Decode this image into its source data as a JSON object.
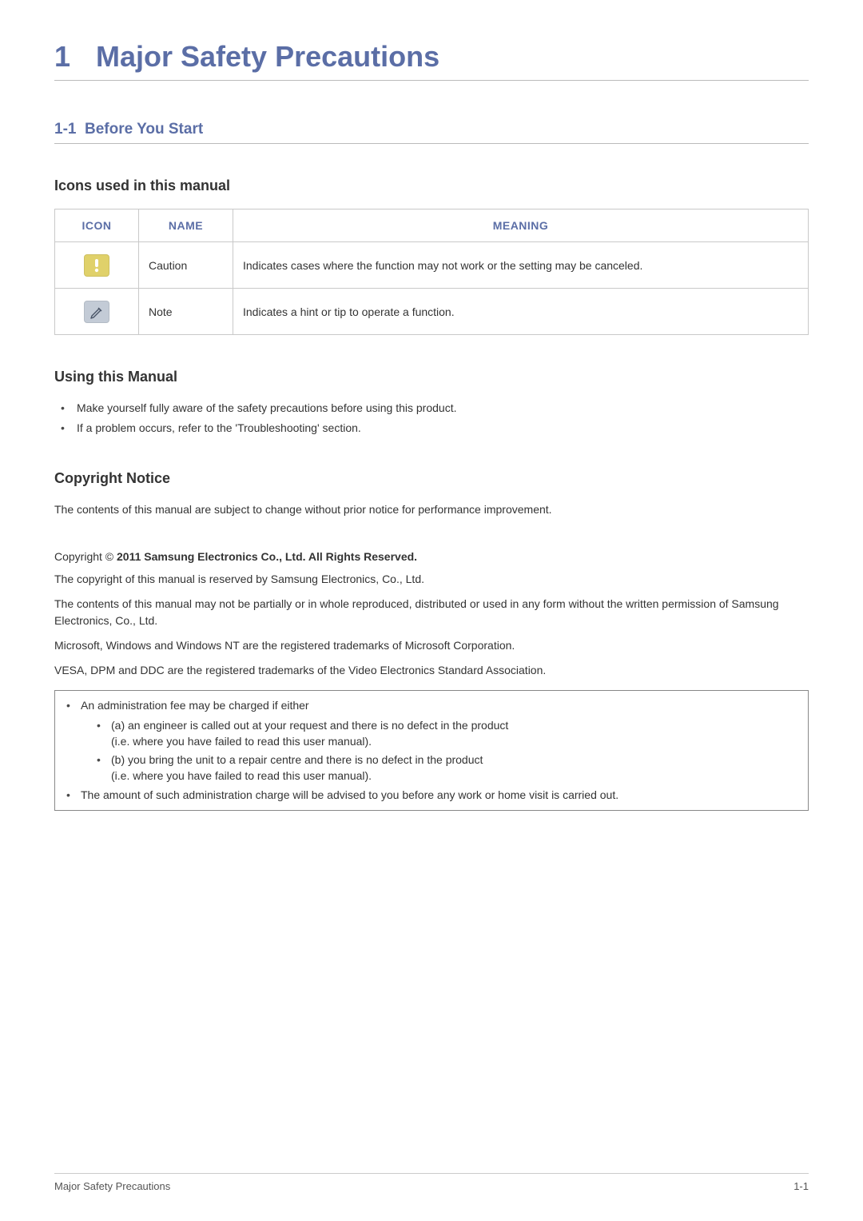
{
  "chapter": {
    "num": "1",
    "title": "Major Safety Precautions"
  },
  "section": {
    "num": "1-1",
    "title": "Before You Start"
  },
  "icons_section_heading": "Icons used in this manual",
  "table": {
    "headers": {
      "icon": "ICON",
      "name": "NAME",
      "meaning": "MEANING"
    },
    "rows": [
      {
        "name": "Caution",
        "meaning": "Indicates cases where the function may not work or the setting may be canceled."
      },
      {
        "name": "Note",
        "meaning": "Indicates a hint or tip to operate a function."
      }
    ]
  },
  "using_heading": "Using this Manual",
  "using_bullets": [
    "Make yourself fully aware of the safety precautions before using this product.",
    "If a problem occurs, refer to the 'Troubleshooting' section."
  ],
  "copyright_heading": "Copyright Notice",
  "copyright_intro": "The contents of this manual are subject to change without prior notice for performance improvement.",
  "copyright_prefix": "Copyright © ",
  "copyright_strong": "2011 Samsung Electronics Co., Ltd. All Rights Reserved.",
  "copyright_paras": [
    "The copyright of this manual is reserved by Samsung Electronics, Co., Ltd.",
    "The contents of this manual may not be partially or in whole reproduced, distributed or used in any form without the written permission of Samsung Electronics, Co., Ltd.",
    "Microsoft, Windows and Windows NT are the registered trademarks of Microsoft Corporation.",
    "VESA, DPM and DDC are the registered trademarks of the Video Electronics Standard Association."
  ],
  "notice": {
    "top1": "An administration fee may be charged if either",
    "sub": [
      {
        "line1": "(a) an engineer is called out at your request and there is no defect in the product",
        "line2": "(i.e. where you have failed to read this user manual)."
      },
      {
        "line1": "(b) you bring the unit to a repair centre and there is no defect in the product",
        "line2": "(i.e. where you have failed to read this user manual)."
      }
    ],
    "top2": "The amount of such administration charge will be advised to you before any work or home visit is carried out."
  },
  "footer": {
    "left": "Major Safety Precautions",
    "right": "1-1"
  }
}
